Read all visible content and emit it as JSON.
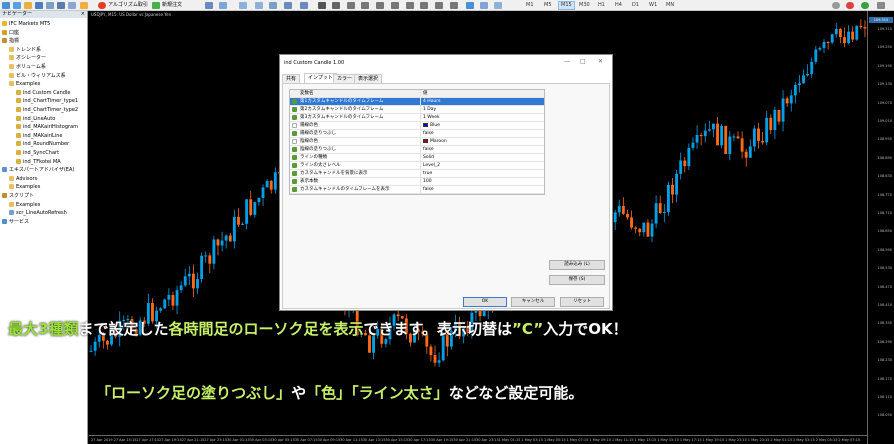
{
  "toolbar": {
    "algo_label": "アルゴリズム取引",
    "new_order_label": "新規注文",
    "timeframes": [
      "M1",
      "M5",
      "M15",
      "M30",
      "H1",
      "H4",
      "D1",
      "W1",
      "MN"
    ],
    "active_timeframe": "M15"
  },
  "navigator": {
    "title": "ナビゲーター",
    "close": "×",
    "items": [
      {
        "label": "IFC Markets MT5",
        "indent": 1,
        "icon": "terminal-icon",
        "color": "#f0b030"
      },
      {
        "label": "口座",
        "indent": 1,
        "icon": "accounts-icon",
        "color": "#d4a020"
      },
      {
        "label": "指標",
        "indent": 1,
        "icon": "indicators-icon",
        "color": "#c09030"
      },
      {
        "label": "トレンド系",
        "indent": 2,
        "icon": "folder-icon",
        "color": "#e8c060"
      },
      {
        "label": "オシレーター",
        "indent": 2,
        "icon": "folder-icon",
        "color": "#e8c060"
      },
      {
        "label": "ボリューム系",
        "indent": 2,
        "icon": "folder-icon",
        "color": "#e8c060"
      },
      {
        "label": "ビル・ウィリアムス系",
        "indent": 2,
        "icon": "folder-icon",
        "color": "#e8c060"
      },
      {
        "label": "Examples",
        "indent": 2,
        "icon": "folder-icon",
        "color": "#e8c060"
      },
      {
        "label": "ind Custom Candle",
        "indent": 3,
        "icon": "indicator-icon",
        "color": "#d8b040"
      },
      {
        "label": "ind_ChartTimer_type1",
        "indent": 3,
        "icon": "indicator-icon",
        "color": "#d8b040"
      },
      {
        "label": "ind_ChartTimer_type2",
        "indent": 3,
        "icon": "indicator-icon",
        "color": "#d8b040"
      },
      {
        "label": "ind_LineAuto",
        "indent": 3,
        "icon": "indicator-icon",
        "color": "#d8b040"
      },
      {
        "label": "ind_MAKairiHistogram",
        "indent": 3,
        "icon": "indicator-icon",
        "color": "#d8b040"
      },
      {
        "label": "ind_MAKairiLine",
        "indent": 3,
        "icon": "indicator-icon",
        "color": "#d8b040"
      },
      {
        "label": "ind_RoundNumber",
        "indent": 3,
        "icon": "indicator-icon",
        "color": "#d8b040"
      },
      {
        "label": "ind_SyncChart",
        "indent": 3,
        "icon": "indicator-icon",
        "color": "#d8b040"
      },
      {
        "label": "ind_TFkotei MA",
        "indent": 3,
        "icon": "indicator-icon",
        "color": "#d8b040"
      },
      {
        "label": "エキスパートアドバイザ(EA)",
        "indent": 1,
        "icon": "expert-icon",
        "color": "#5a8fd0"
      },
      {
        "label": "Advisors",
        "indent": 2,
        "icon": "folder-icon",
        "color": "#e8c060"
      },
      {
        "label": "Examples",
        "indent": 2,
        "icon": "folder-icon",
        "color": "#e8c060"
      },
      {
        "label": "スクリプト",
        "indent": 1,
        "icon": "scripts-icon",
        "color": "#c09030"
      },
      {
        "label": "Examples",
        "indent": 2,
        "icon": "folder-icon",
        "color": "#e8c060"
      },
      {
        "label": "scr_LineAutoRefresh",
        "indent": 2,
        "icon": "script-icon",
        "color": "#6fa0d8"
      },
      {
        "label": "サービス",
        "indent": 1,
        "icon": "services-icon",
        "color": "#4f8fcf"
      }
    ]
  },
  "chart": {
    "title": "USDJPY, M15: US Dollar vs Japanese Yen",
    "current_price": "109.315",
    "price_labels": [
      "109.315",
      "109.250",
      "109.190",
      "109.130",
      "109.070",
      "109.010",
      "108.950",
      "108.890",
      "108.830",
      "108.770",
      "108.710",
      "108.650",
      "108.590",
      "108.530",
      "108.470",
      "108.410",
      "108.350",
      "108.290",
      "108.230",
      "108.170",
      "108.110",
      "108.050"
    ],
    "time_labels": [
      "27 Apr 2019",
      "27 Apr 15:15",
      "27 Apr 17:15",
      "27 Apr 19:15",
      "27 Apr 21:15",
      "27 Apr 23:15",
      "30 Apr 01:15",
      "30 Apr 03:15",
      "30 Apr 05:15",
      "30 Apr 07:15",
      "30 Apr 09:15",
      "30 Apr 11:15",
      "30 Apr 13:15",
      "30 Apr 15:15",
      "30 Apr 17:15",
      "30 Apr 19:15",
      "30 Apr 21:15",
      "30 Apr 23:15",
      "1 May 01:15",
      "1 May 03:15",
      "1 May 05:15",
      "1 May 07:15",
      "1 May 09:15",
      "1 May 11:15",
      "1 May 13:15",
      "1 May 15:15",
      "1 May 17:15",
      "1 May 19:15",
      "1 May 21:15",
      "1 May 23:15",
      "2 May 01:15",
      "2 May 03:15",
      "2 May 05:15",
      "2 May 07:15"
    ],
    "bull_color": "#00a0e8",
    "bear_color": "#ff6a1a"
  },
  "dialog": {
    "title": "ind Custom Candle 1.00",
    "minimize": "—",
    "maximize": "□",
    "close": "✕",
    "tabs": [
      "共有",
      "インプット",
      "カラー",
      "表示選択"
    ],
    "active_tab": 1,
    "col_name": "変数名",
    "col_value": "値",
    "rows": [
      {
        "name": "第1カスタムキャンドルのタイムフレーム",
        "value": "4 Hours",
        "icon": "param-icon",
        "selected": true
      },
      {
        "name": "第2カスタムキャンドルのタイムフレーム",
        "value": "1 Day",
        "icon": "param-icon"
      },
      {
        "name": "第3カスタムキャンドルのタイムフレーム",
        "value": "1 Week",
        "icon": "param-icon"
      },
      {
        "name": "陽線の色",
        "value": "Blue",
        "icon": "check-icon",
        "swatch": "#0000ff"
      },
      {
        "name": "陽線の塗りつぶし",
        "value": "false",
        "icon": "param-icon"
      },
      {
        "name": "陰線の色",
        "value": "Maroon",
        "icon": "check-icon",
        "swatch": "#b00000"
      },
      {
        "name": "陰線の塗りつぶし",
        "value": "false",
        "icon": "param-icon"
      },
      {
        "name": "ラインの種類",
        "value": "Solid",
        "icon": "param-icon"
      },
      {
        "name": "ラインの太さレベル",
        "value": "Level_2",
        "icon": "param-icon"
      },
      {
        "name": "カスタムキャンドルを背景に表示",
        "value": "true",
        "icon": "param-icon"
      },
      {
        "name": "表示本数",
        "value": "100",
        "icon": "param-icon"
      },
      {
        "name": "カスタムキャンドルのタイムフレームを表示",
        "value": "false",
        "icon": "param-icon"
      }
    ],
    "load_button": "読み込み (L)",
    "save_button": "保存 (S)",
    "ok_button": "OK",
    "cancel_button": "キャンセル",
    "reset_button": "リセット"
  },
  "captions": {
    "line1": {
      "a": "最大3種類",
      "b": "まで設定した",
      "c": "各時間足のローソク足を表示",
      "d": "できます。表示切替は",
      "e": "”C”",
      "f": "入力でOK！"
    },
    "line2": {
      "a": "「ローソク足の塗りつぶし」",
      "b": "や",
      "c": "「色」「ライン太さ」",
      "d": "などなど設定可能。"
    }
  }
}
